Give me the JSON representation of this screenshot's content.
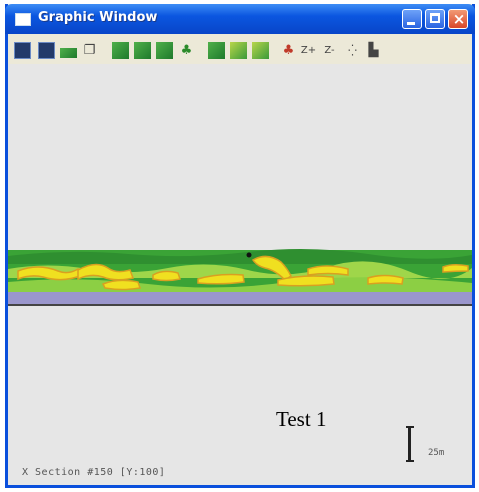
{
  "window": {
    "title": "Graphic Window",
    "title_bar_color": "#0b56e0"
  },
  "toolbar": {
    "groups": [
      [
        "view-3d-icon",
        "view-plan-icon",
        "terrain-icon",
        "window-icon"
      ],
      [
        "layer-icon-1",
        "layer-icon-2",
        "layer-icon-3",
        "tree-icon"
      ],
      [
        "map-icon-1",
        "map-icon-2",
        "map-icon-3"
      ],
      [
        "tree-red-icon",
        "zoom-in-icon",
        "zoom-out-icon",
        "crosshair-icon",
        "camera-icon"
      ]
    ],
    "labels": {
      "zoom_in": "Z+",
      "zoom_out": "Z-"
    }
  },
  "canvas": {
    "label": "Test 1",
    "scale": "25m",
    "status": "X Section #150 [Y:100]"
  },
  "colors": {
    "vegetation_dark": "#3aa336",
    "vegetation_light": "#9fd64a",
    "fire": "#f0e020",
    "burn": "#d9a020",
    "base_layer": "#9a96cc",
    "background": "#e6e6e6"
  }
}
